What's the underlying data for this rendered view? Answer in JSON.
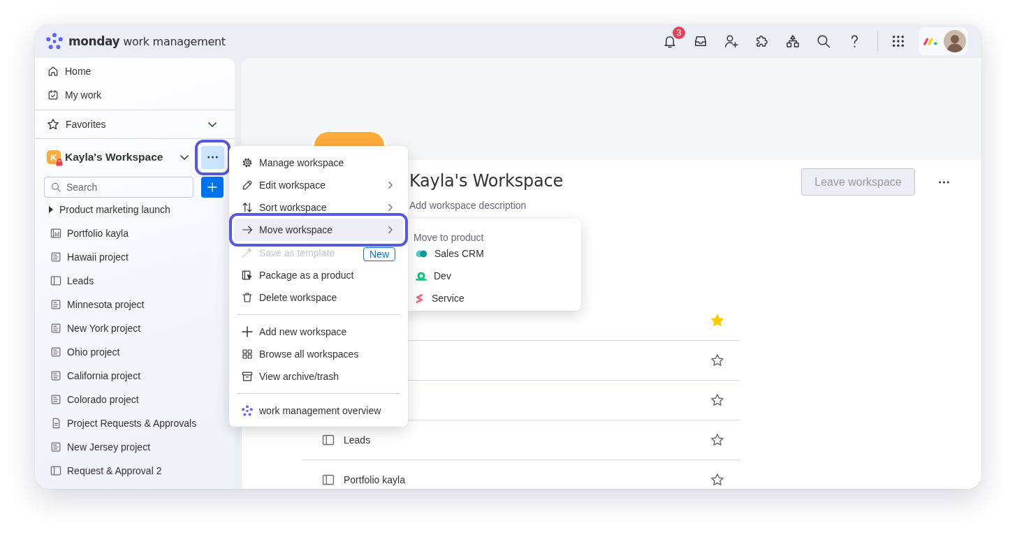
{
  "top_bar": {
    "logo": {
      "brand": "monday",
      "product": "work management"
    },
    "notifications": {
      "badge": "3"
    }
  },
  "sidebar": {
    "nav": [
      {
        "label": "Home"
      },
      {
        "label": "My work"
      }
    ],
    "favorites": {
      "label": "Favorites"
    },
    "workspace": {
      "initial": "K",
      "name": "Kayla's Workspace",
      "private": true,
      "more_button": {
        "active": true,
        "highlighted": true
      }
    },
    "search": {
      "placeholder": "Search"
    },
    "items": [
      {
        "label": "Product marketing launch",
        "kind": "folder",
        "expanded": false
      },
      {
        "label": "Portfolio kayla",
        "kind": "portfolio"
      },
      {
        "label": "Hawaii project",
        "kind": "board"
      },
      {
        "label": "Leads",
        "kind": "panel"
      },
      {
        "label": "Minnesota project",
        "kind": "board"
      },
      {
        "label": "New York project",
        "kind": "board"
      },
      {
        "label": "Ohio project",
        "kind": "board"
      },
      {
        "label": "California project",
        "kind": "board"
      },
      {
        "label": "Colorado project",
        "kind": "board"
      },
      {
        "label": "Project Requests & Approvals",
        "kind": "doc"
      },
      {
        "label": "New Jersey project",
        "kind": "board"
      },
      {
        "label": "Request & Approval 2",
        "kind": "panel"
      }
    ]
  },
  "workspace_menu": {
    "sections": [
      {
        "items": [
          {
            "label": "Manage workspace",
            "has_submenu": false,
            "disabled": false,
            "active": false,
            "highlighted": false
          },
          {
            "label": "Edit workspace",
            "has_submenu": true,
            "disabled": false,
            "active": false,
            "highlighted": false
          },
          {
            "label": "Sort workspace",
            "has_submenu": true,
            "disabled": false,
            "active": false,
            "highlighted": false
          },
          {
            "label": "Move workspace",
            "has_submenu": true,
            "disabled": false,
            "active": true,
            "highlighted": true
          },
          {
            "label": "Save as template",
            "has_submenu": false,
            "disabled": true,
            "active": false,
            "highlighted": false,
            "badge": "New"
          },
          {
            "label": "Package as a product",
            "has_submenu": false,
            "disabled": false,
            "active": false,
            "highlighted": false
          },
          {
            "label": "Delete workspace",
            "has_submenu": false,
            "disabled": false,
            "active": false,
            "highlighted": false
          }
        ]
      },
      {
        "items": [
          {
            "label": "Add new workspace",
            "has_submenu": false,
            "disabled": false,
            "active": false,
            "highlighted": false
          },
          {
            "label": "Browse all workspaces",
            "has_submenu": false,
            "disabled": false,
            "active": false,
            "highlighted": false
          },
          {
            "label": "View archive/trash",
            "has_submenu": false,
            "disabled": false,
            "active": false,
            "highlighted": false
          }
        ]
      },
      {
        "items": [
          {
            "label": "work management overview",
            "has_submenu": false,
            "disabled": false,
            "active": false,
            "highlighted": false
          }
        ]
      }
    ]
  },
  "move_submenu": {
    "title": "Move to product",
    "items": [
      {
        "label": "Sales CRM"
      },
      {
        "label": "Dev"
      },
      {
        "label": "Service"
      }
    ]
  },
  "main": {
    "title": "Kayla's Workspace",
    "description": {
      "placeholder": "Add workspace description"
    },
    "leave_button": {
      "label": "Leave workspace",
      "disabled": true
    },
    "rows": [
      {
        "starred": true
      },
      {
        "starred": false
      },
      {
        "starred": false
      },
      {
        "label": "Leads",
        "kind": "panel",
        "starred": false
      },
      {
        "label": "Portfolio kayla",
        "kind": "panel",
        "starred": false
      }
    ]
  }
}
